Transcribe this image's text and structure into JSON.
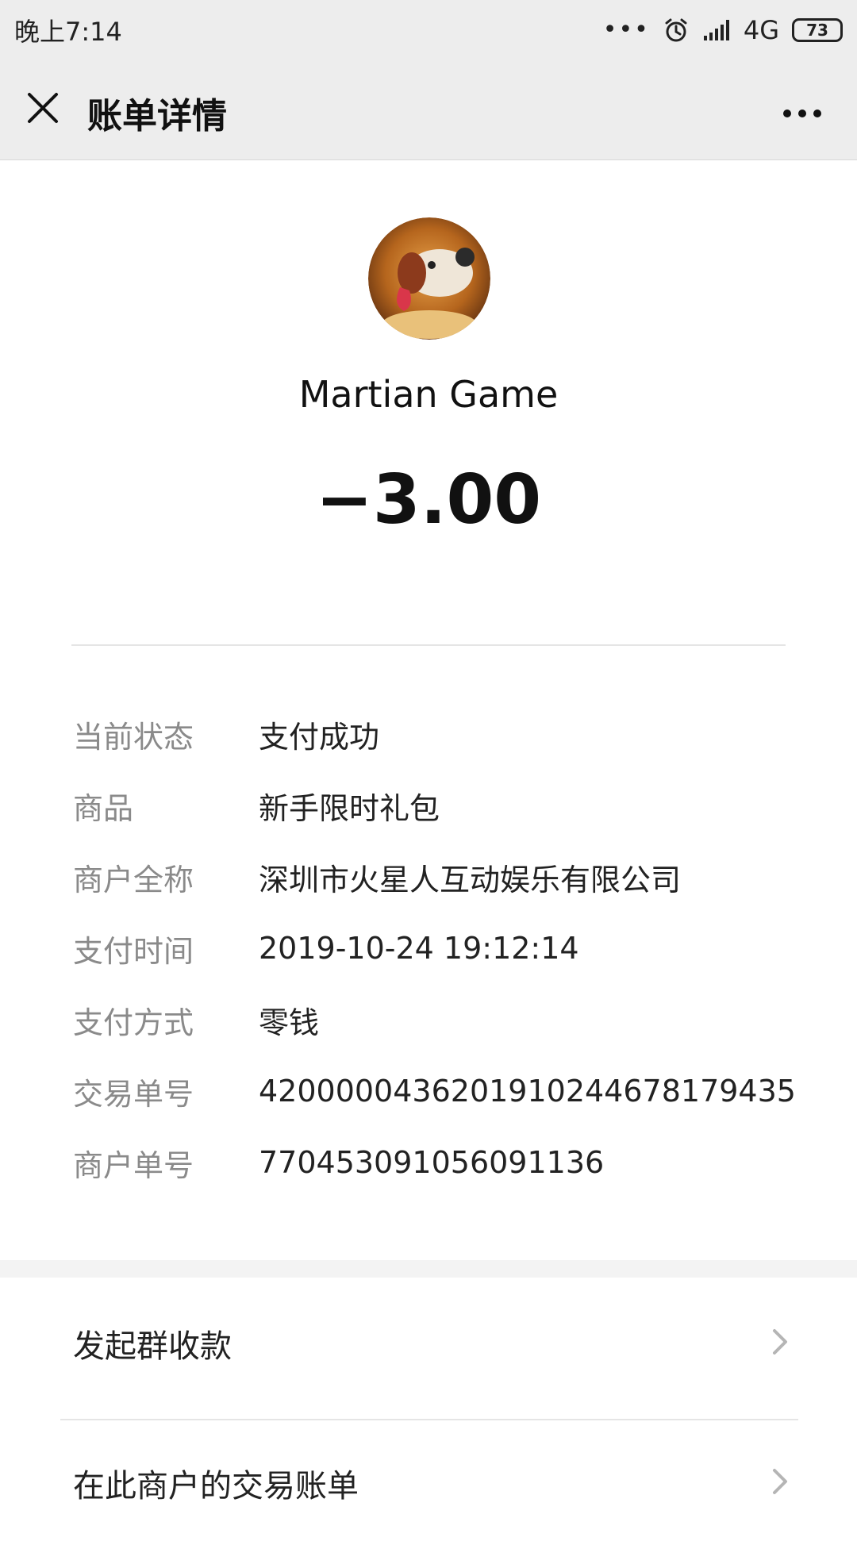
{
  "status_bar": {
    "time": "晚上7:14",
    "dots": "•••",
    "network": "4G",
    "battery": "73",
    "icons": [
      "alarm-icon",
      "signal-icon",
      "battery-icon"
    ]
  },
  "nav": {
    "title": "账单详情",
    "close_icon": "close-icon",
    "more_icon": "more-icon"
  },
  "merchant": {
    "name": "Martian Game",
    "amount": "−3.00"
  },
  "details": [
    {
      "key": "当前状态",
      "value": "支付成功"
    },
    {
      "key": "商品",
      "value": "新手限时礼包"
    },
    {
      "key": "商户全称",
      "value": "深圳市火星人互动娱乐有限公司"
    },
    {
      "key": "支付时间",
      "value": "2019-10-24 19:12:14"
    },
    {
      "key": "支付方式",
      "value": "零钱"
    },
    {
      "key": "交易单号",
      "value": "4200000436201910244678179435"
    },
    {
      "key": "商户单号",
      "value": "770453091056091136"
    }
  ],
  "actions": [
    {
      "label": "发起群收款"
    },
    {
      "label": "在此商户的交易账单"
    }
  ],
  "colors": {
    "bar_bg": "#ededed",
    "muted_text": "#8a8a8a",
    "divider": "#e5e5e5"
  }
}
